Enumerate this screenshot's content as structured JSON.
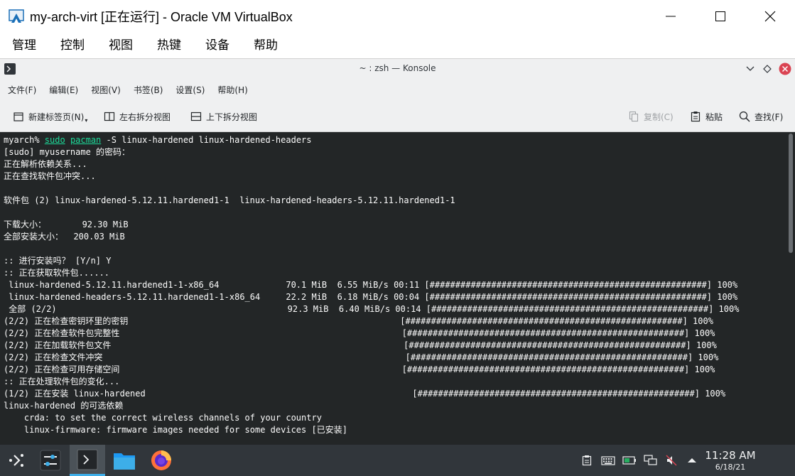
{
  "vbox": {
    "title": "my-arch-virt [正在运行] - Oracle VM VirtualBox",
    "menus": [
      "管理",
      "控制",
      "视图",
      "热键",
      "设备",
      "帮助"
    ]
  },
  "konsole": {
    "title": "~ : zsh — Konsole",
    "menus": [
      "文件(F)",
      "编辑(E)",
      "视图(V)",
      "书签(B)",
      "设置(S)",
      "帮助(H)"
    ],
    "toolbar": {
      "new_tab": "新建标签页(N)",
      "split_lr": "左右拆分视图",
      "split_tb": "上下拆分视图",
      "copy": "复制(C)",
      "paste": "粘贴",
      "find": "查找(F)"
    }
  },
  "terminal": {
    "prompt": "myarch% ",
    "cmd_sudo": "sudo",
    "cmd_pacman": "pacman",
    "cmd_args": " -S linux-hardened linux-hardened-headers",
    "lines": [
      "[sudo] myusername 的密码：",
      "正在解析依赖关系...",
      "正在查找软件包冲突...",
      "",
      "软件包 (2) linux-hardened-5.12.11.hardened1-1  linux-hardened-headers-5.12.11.hardened1-1",
      "",
      "下载大小：       92.30 MiB",
      "全部安装大小：  200.03 MiB",
      "",
      ":: 进行安装吗？ [Y/n] Y",
      ":: 正在获取软件包......",
      " linux-hardened-5.12.11.hardened1-1-x86_64             70.1 MiB  6.55 MiB/s 00:11 [######################################################] 100%",
      " linux-hardened-headers-5.12.11.hardened1-1-x86_64     22.2 MiB  6.18 MiB/s 00:04 [######################################################] 100%",
      " 全部 (2/2)                                             92.3 MiB  6.40 MiB/s 00:14 [######################################################] 100%",
      "(2/2) 正在检查密钥环里的密钥                                                     [######################################################] 100%",
      "(2/2) 正在检查软件包完整性                                                       [######################################################] 100%",
      "(2/2) 正在加载软件包文件                                                         [######################################################] 100%",
      "(2/2) 正在检查文件冲突                                                           [######################################################] 100%",
      "(2/2) 正在检查可用存储空间                                                       [######################################################] 100%",
      ":: 正在处理软件包的变化...",
      "(1/2) 正在安装 linux-hardened                                                    [######################################################] 100%",
      "linux-hardened 的可选依赖",
      "    crda: to set the correct wireless channels of your country",
      "    linux-firmware: firmware images needed for some devices [已安装]"
    ]
  },
  "taskbar": {
    "time": "11:28 AM",
    "date": "6/18/21"
  },
  "colors": {
    "terminal_bg": "#232627",
    "terminal_fg": "#fcfcfc",
    "command_green": "#1cdc9a",
    "taskbar_bg": "#31363b",
    "konsole_chrome": "#eff0f1",
    "close_red": "#da4453"
  },
  "icons": [
    "virtualbox-icon",
    "minimize-icon",
    "maximize-icon",
    "close-icon",
    "konsole-icon",
    "chevron-down-icon",
    "keep-above-icon",
    "konsole-close-icon",
    "new-tab-icon",
    "split-lr-icon",
    "split-tb-icon",
    "copy-icon",
    "paste-icon",
    "search-icon",
    "app-launcher-icon",
    "settings-sliders-icon",
    "terminal-icon",
    "folder-icon",
    "firefox-icon",
    "clipboard-icon",
    "keyboard-icon",
    "battery-icon",
    "network-icon",
    "volume-muted-icon",
    "tray-expand-icon"
  ]
}
